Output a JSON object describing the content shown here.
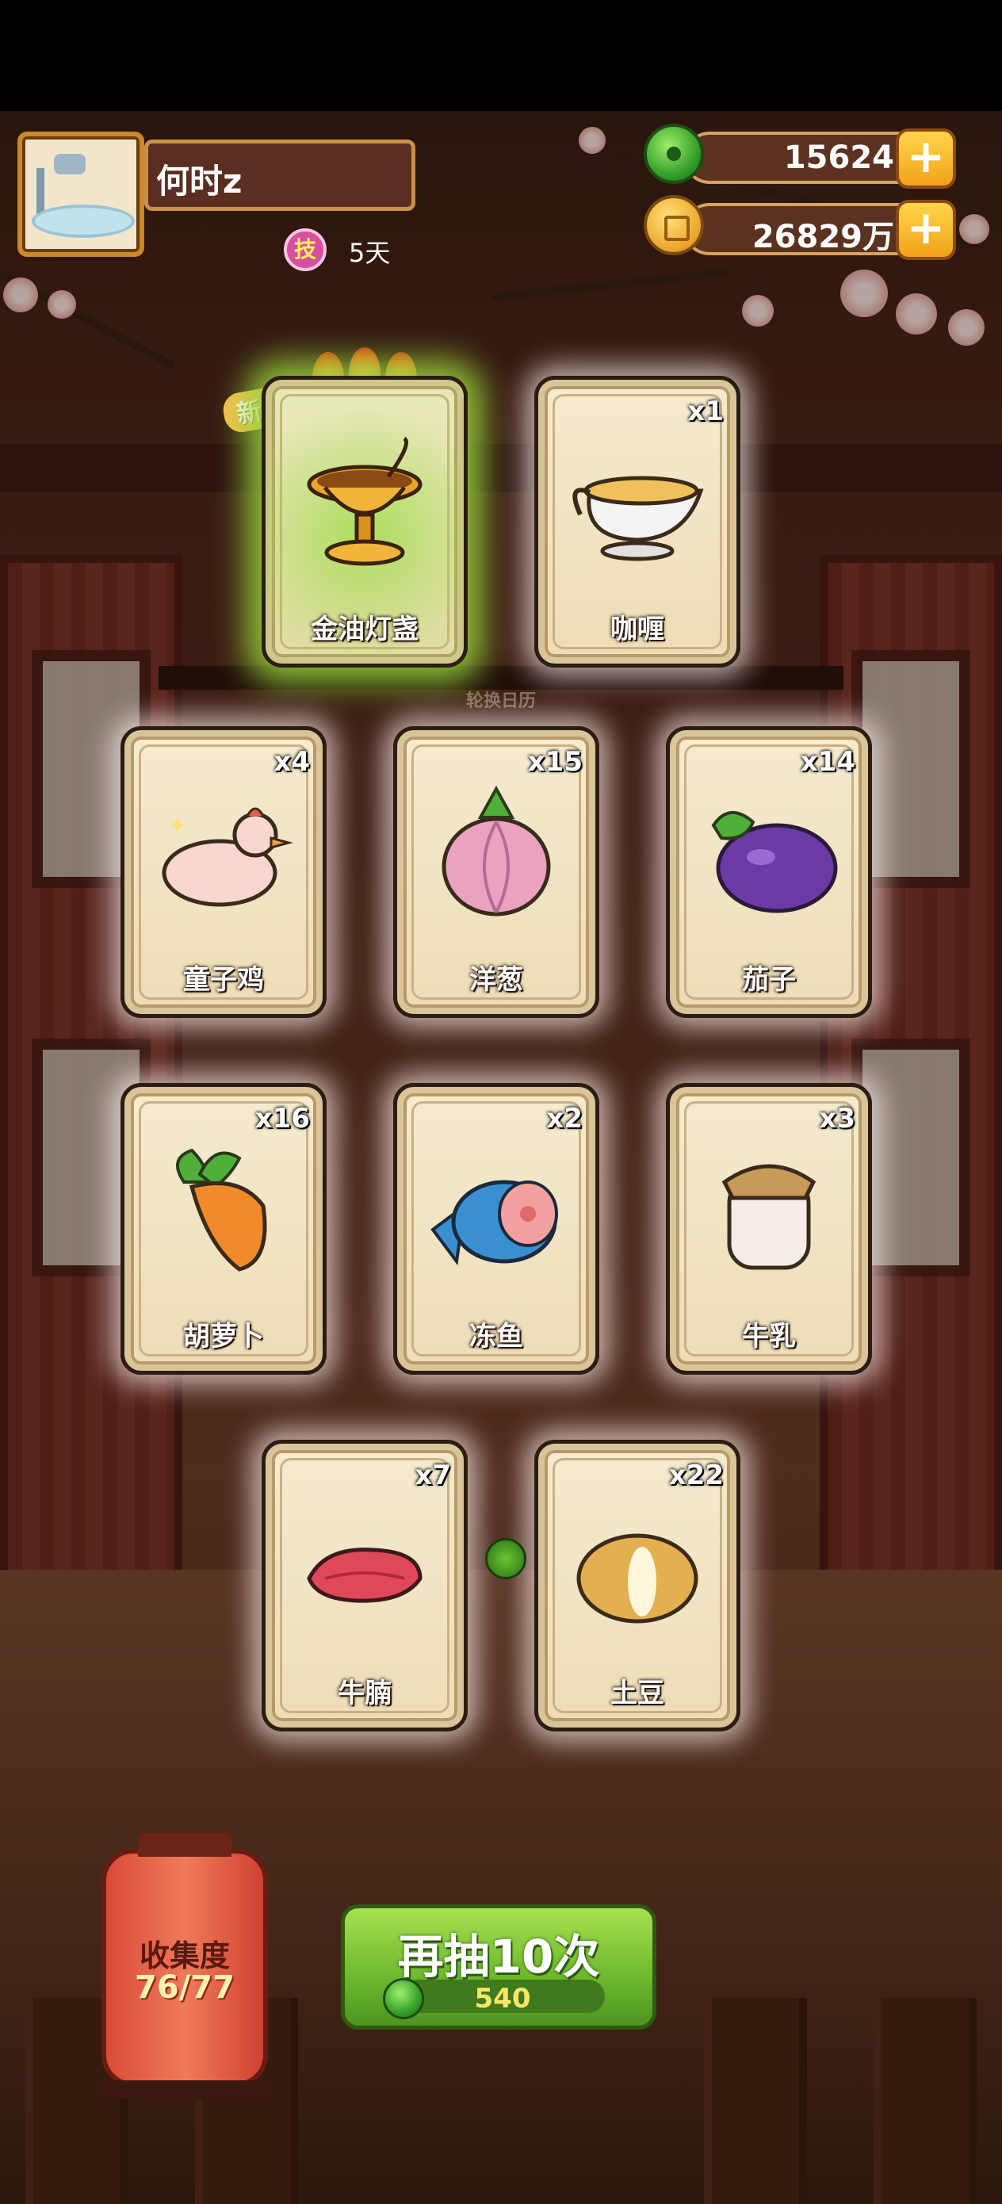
{
  "player": {
    "name": "何时z",
    "skill_badge": "技",
    "days": "5天"
  },
  "currency": {
    "jade": "15624",
    "coins": "26829万",
    "plus_label": "+"
  },
  "background_sign": "轮换日历",
  "new_label": "新!",
  "cards": [
    {
      "name": "金油灯盏",
      "count": "",
      "icon": "oil-lamp-icon",
      "is_new": true
    },
    {
      "name": "咖喱",
      "count": "x1",
      "icon": "curry-gravy-boat-icon"
    },
    {
      "name": "童子鸡",
      "count": "x4",
      "icon": "spring-chicken-icon"
    },
    {
      "name": "洋葱",
      "count": "x15",
      "icon": "onion-icon"
    },
    {
      "name": "茄子",
      "count": "x14",
      "icon": "eggplant-icon"
    },
    {
      "name": "胡萝卜",
      "count": "x16",
      "icon": "carrot-icon"
    },
    {
      "name": "冻鱼",
      "count": "x2",
      "icon": "frozen-fish-icon"
    },
    {
      "name": "牛乳",
      "count": "x3",
      "icon": "milk-jar-icon"
    },
    {
      "name": "牛腩",
      "count": "x7",
      "icon": "beef-brisket-icon"
    },
    {
      "name": "土豆",
      "count": "x22",
      "icon": "potato-icon"
    }
  ],
  "collection": {
    "label": "收集度",
    "value": "76/77"
  },
  "draw_button": {
    "label": "再抽10次",
    "cost": "540"
  },
  "colors": {
    "glow_new": "#96d23c",
    "draw_green": "#6cb82c",
    "lantern_red": "#d94a3a"
  }
}
